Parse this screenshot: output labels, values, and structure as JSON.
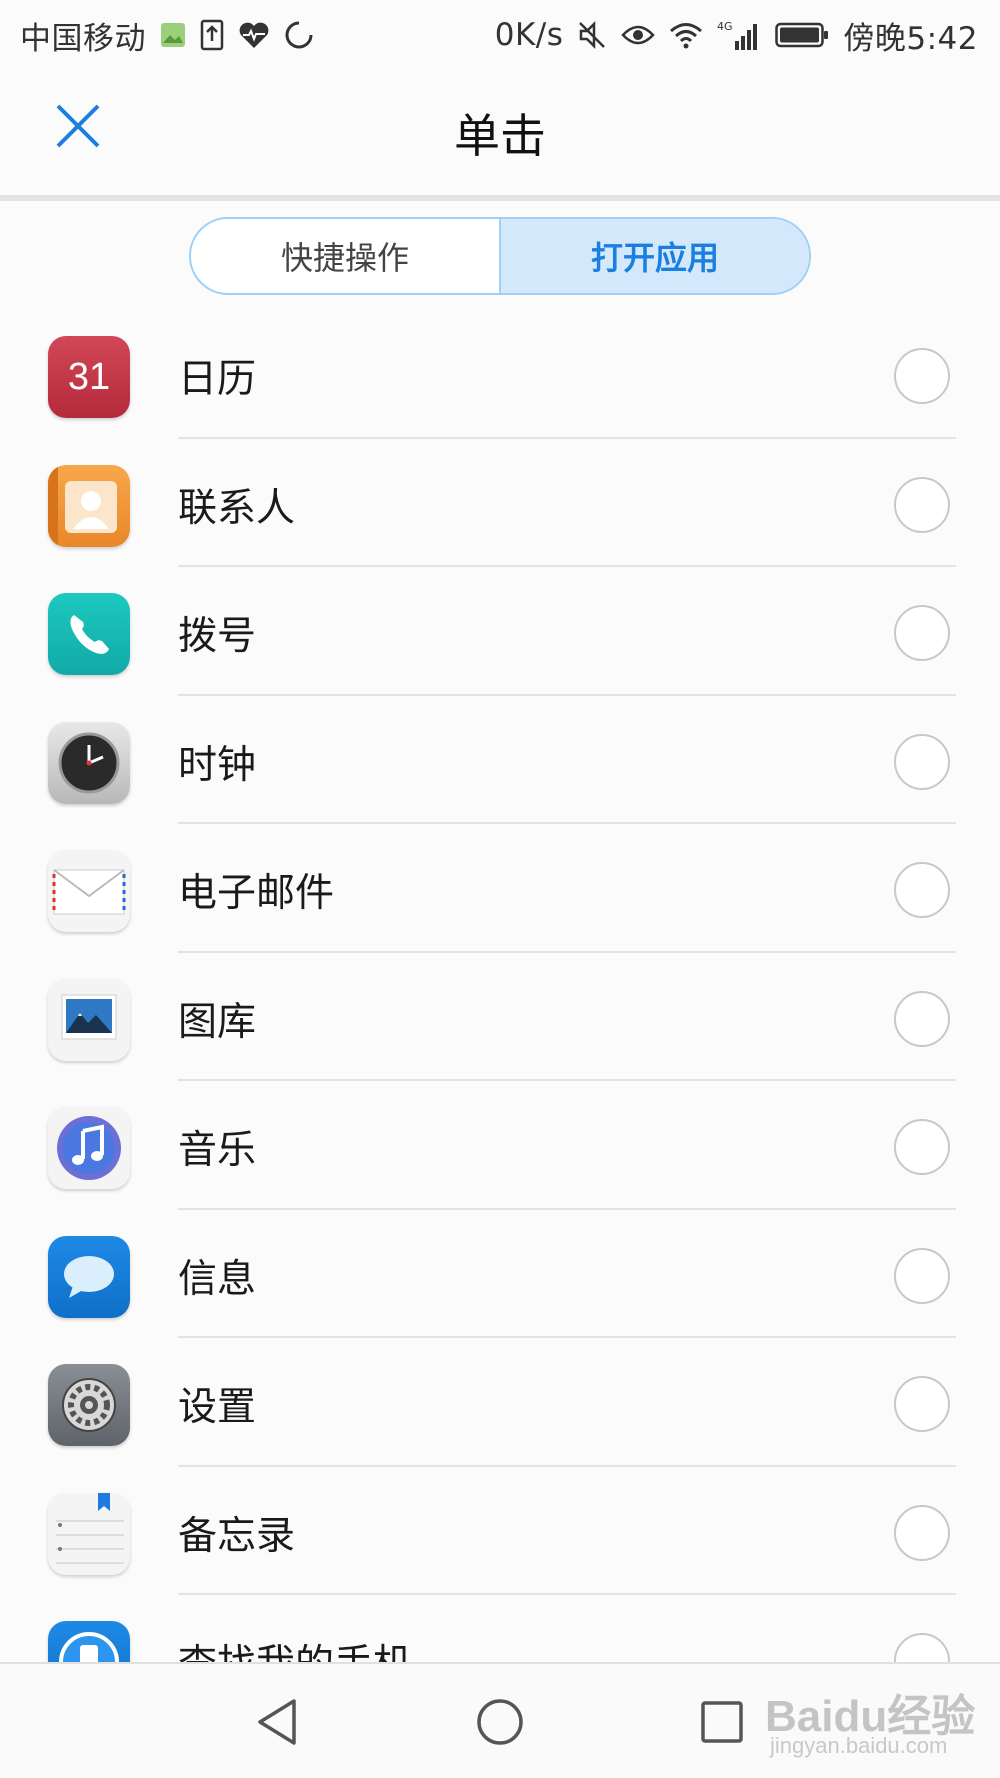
{
  "status_bar": {
    "carrier": "中国移动",
    "net_speed": "0K/s",
    "network": "4G",
    "time": "傍晚5:42",
    "icons": [
      "image-icon",
      "upload-icon",
      "heartbeat-icon",
      "sync-icon",
      "mute-icon",
      "eye-icon",
      "wifi-icon",
      "signal-icon",
      "battery-icon"
    ]
  },
  "header": {
    "title": "单击",
    "close_icon": "close-icon"
  },
  "tabs": [
    {
      "label": "快捷操作",
      "active": false
    },
    {
      "label": "打开应用",
      "active": true
    }
  ],
  "apps": [
    {
      "name": "日历",
      "icon": "calendar-icon",
      "icon_text": "31",
      "selected": false
    },
    {
      "name": "联系人",
      "icon": "contacts-icon",
      "selected": false
    },
    {
      "name": "拨号",
      "icon": "dialer-icon",
      "selected": false
    },
    {
      "name": "时钟",
      "icon": "clock-icon",
      "selected": false
    },
    {
      "name": "电子邮件",
      "icon": "email-icon",
      "selected": false
    },
    {
      "name": "图库",
      "icon": "gallery-icon",
      "selected": false
    },
    {
      "name": "音乐",
      "icon": "music-icon",
      "selected": false
    },
    {
      "name": "信息",
      "icon": "messages-icon",
      "selected": false
    },
    {
      "name": "设置",
      "icon": "settings-icon",
      "selected": false
    },
    {
      "name": "备忘录",
      "icon": "notes-icon",
      "selected": false
    },
    {
      "name": "查找我的手机",
      "icon": "find-phone-icon",
      "selected": false
    }
  ],
  "nav": {
    "icons": [
      "back-icon",
      "home-icon",
      "recents-icon"
    ]
  },
  "watermark": {
    "logo": "Baidu经验",
    "url": "jingyan.baidu.com"
  },
  "colors": {
    "accent": "#1a7fe0",
    "tab_active_bg": "#d3e9fb",
    "tab_border": "#9fd0f5"
  }
}
